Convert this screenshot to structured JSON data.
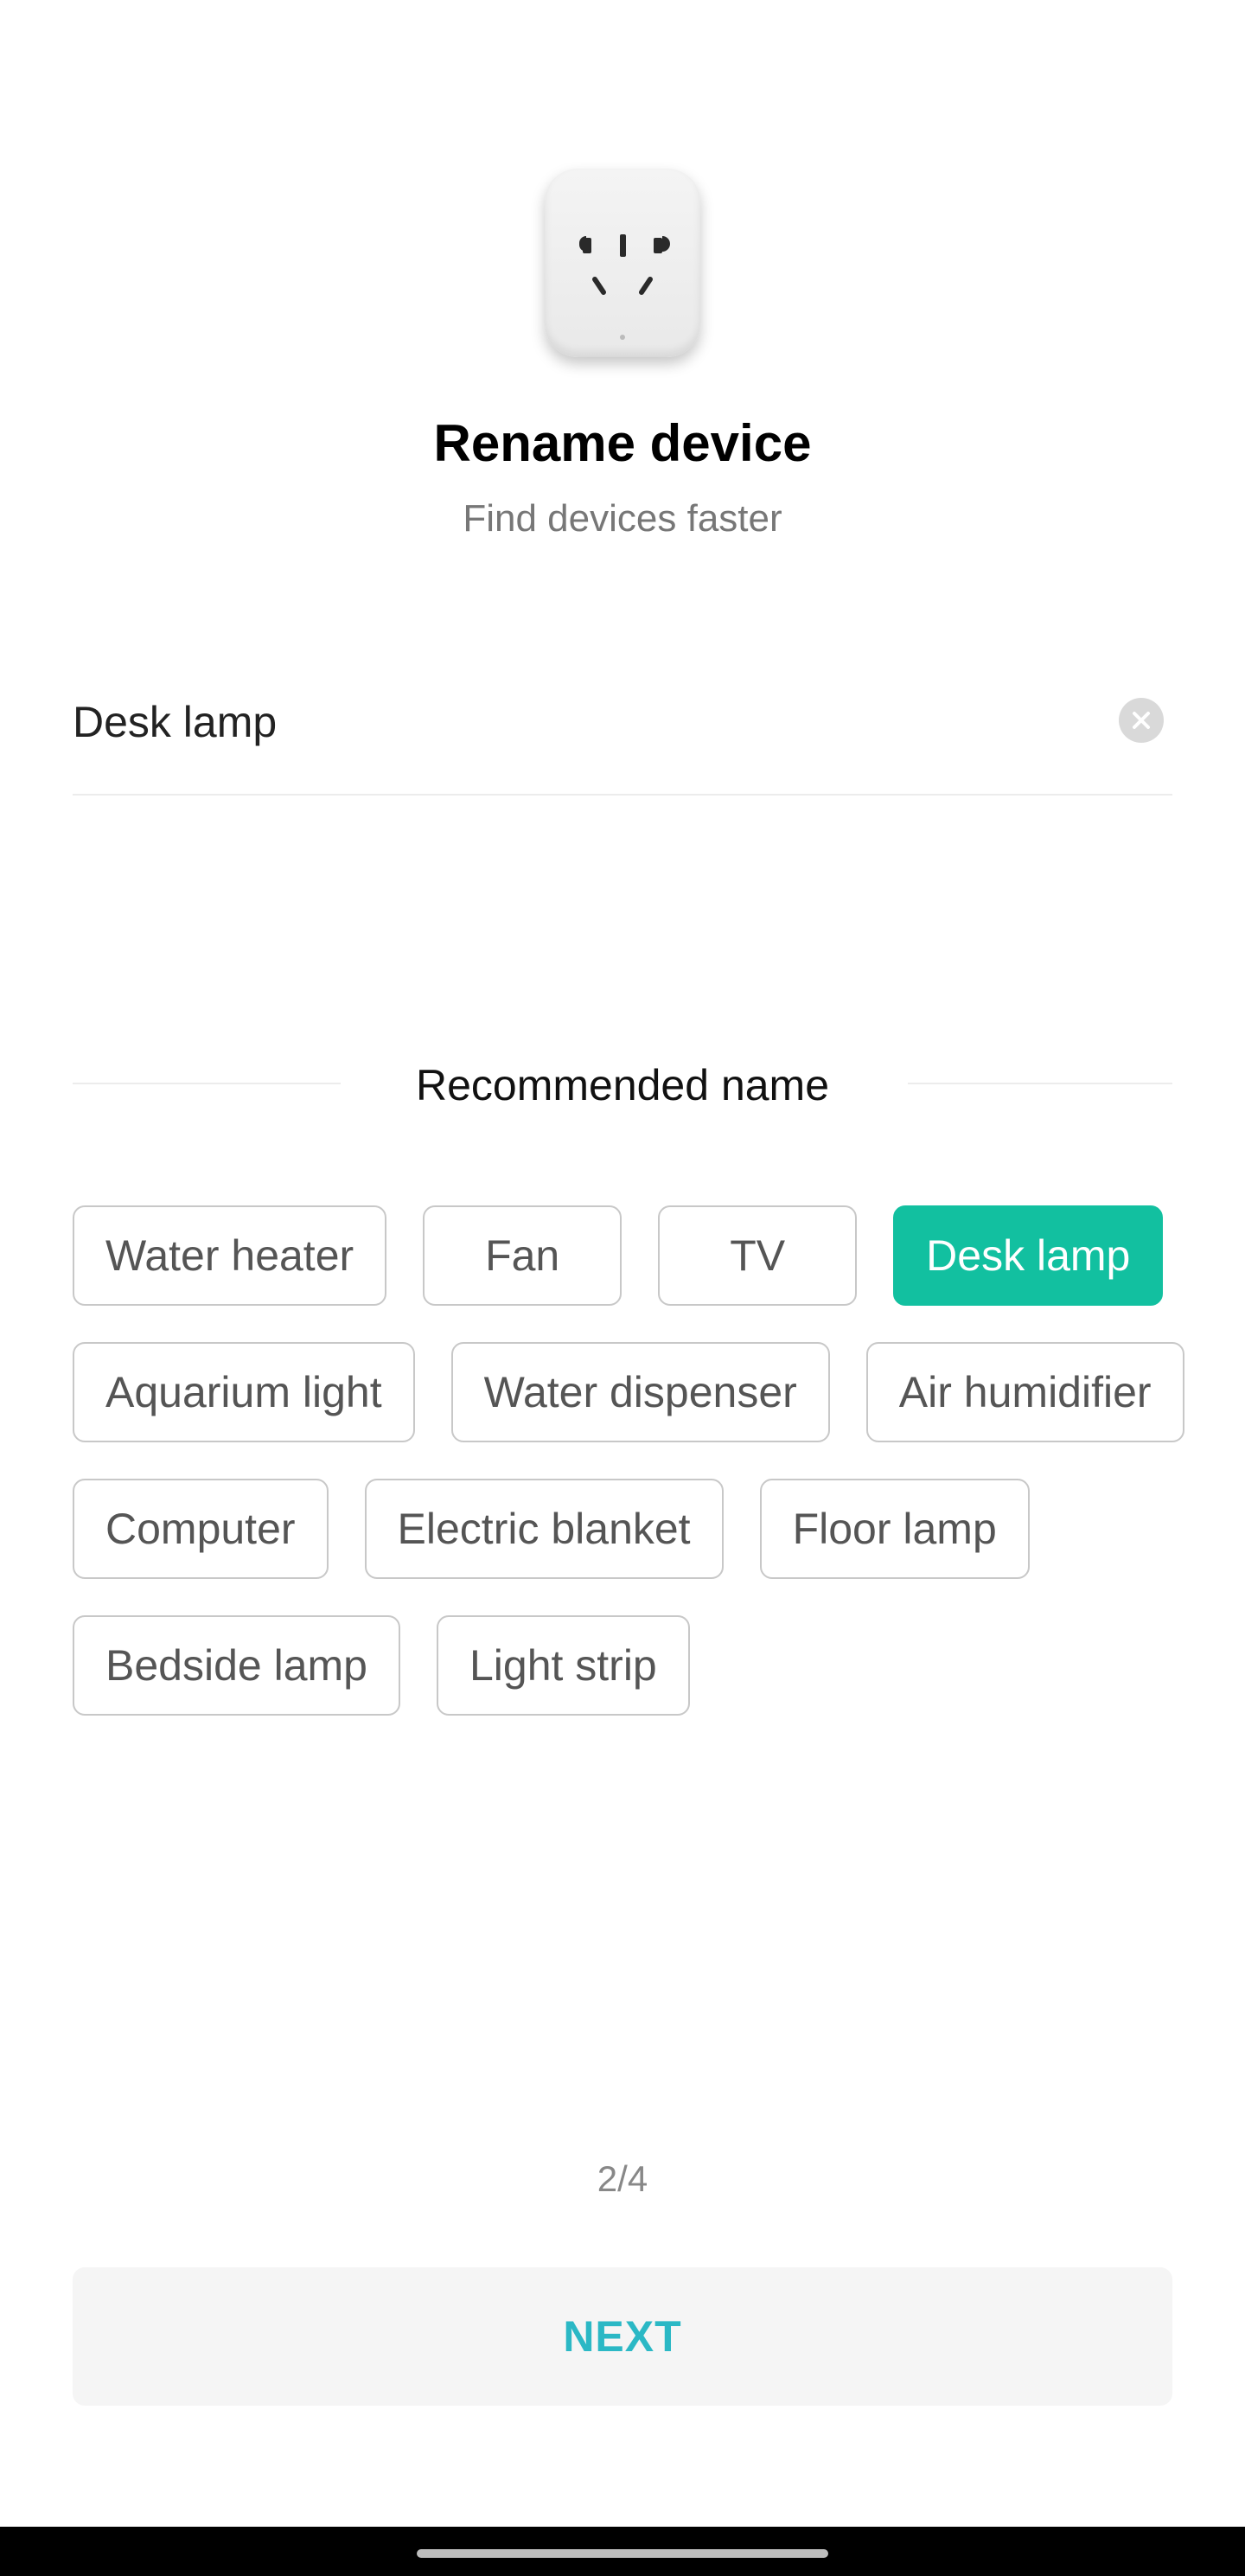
{
  "header": {
    "device_icon": "smart-plug-icon",
    "title": "Rename device",
    "subtitle": "Find devices faster"
  },
  "name_field": {
    "value": "Desk lamp",
    "clear_icon": "clear-icon"
  },
  "recommended": {
    "label": "Recommended name",
    "selected": "Desk lamp",
    "names": [
      "Water heater",
      "Fan",
      "TV",
      "Desk lamp",
      "Aquarium light",
      "Water dispenser",
      "Air humidifier",
      "Computer",
      "Electric blanket",
      "Floor lamp",
      "Bedside lamp",
      "Light strip"
    ]
  },
  "pager": {
    "text": "2/4"
  },
  "footer": {
    "next_label": "NEXT"
  },
  "colors": {
    "accent": "#12c0a0",
    "next_text": "#2bb8c5",
    "chip_border": "#c8c8c8"
  }
}
